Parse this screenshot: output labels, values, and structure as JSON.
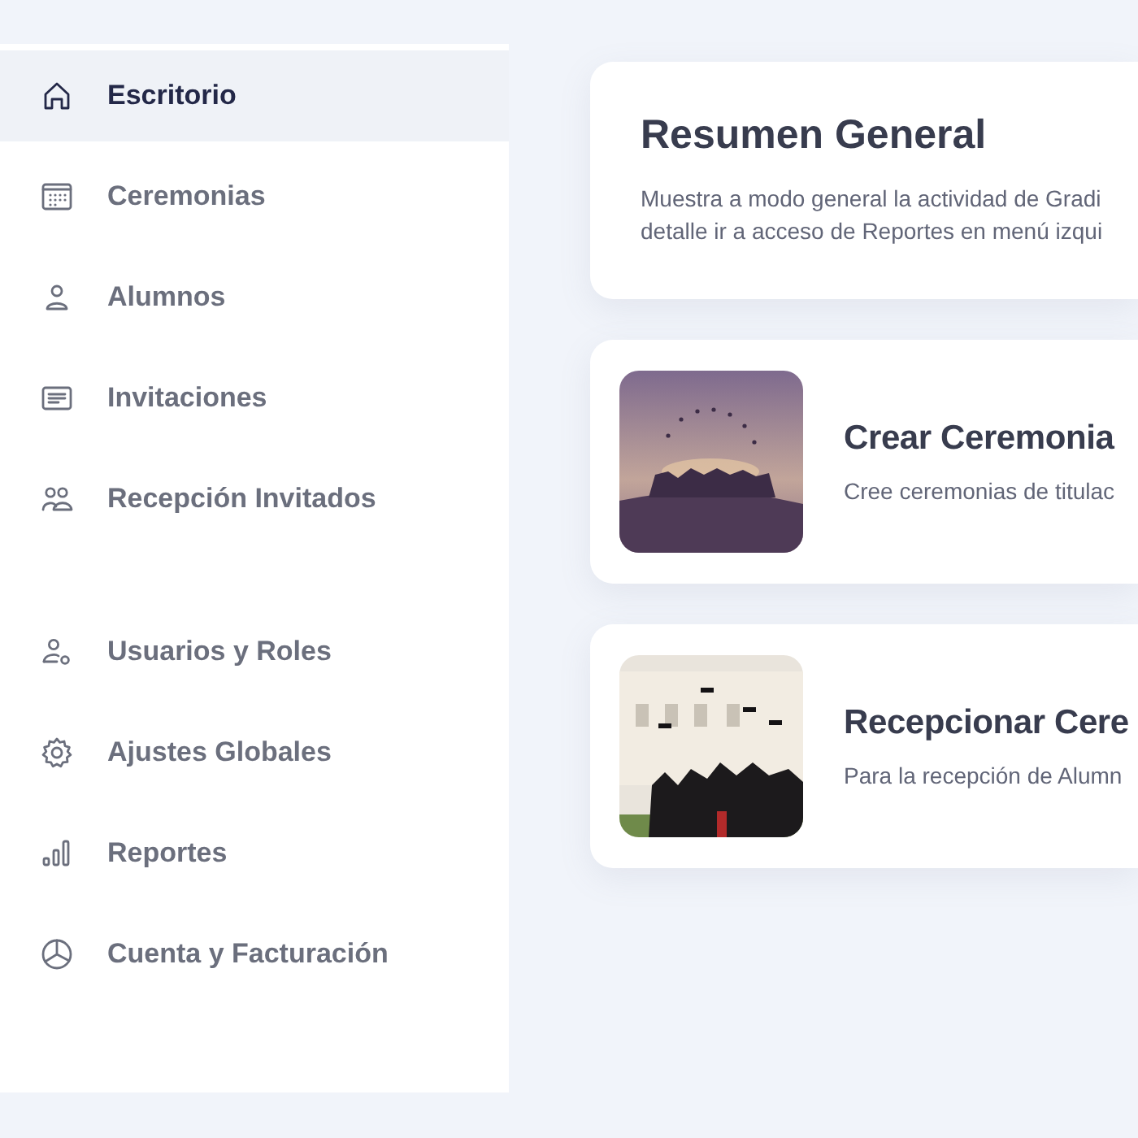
{
  "sidebar": {
    "sections": [
      {
        "items": [
          {
            "label": "Escritorio",
            "selected": true
          },
          {
            "label": "Ceremonias",
            "selected": false
          },
          {
            "label": "Alumnos",
            "selected": false
          },
          {
            "label": "Invitaciones",
            "selected": false
          },
          {
            "label": "Recepción Invitados",
            "selected": false
          }
        ]
      },
      {
        "items": [
          {
            "label": "Usuarios y Roles",
            "selected": false
          },
          {
            "label": "Ajustes Globales",
            "selected": false
          },
          {
            "label": "Reportes",
            "selected": false
          },
          {
            "label": "Cuenta y Facturación",
            "selected": false
          }
        ]
      }
    ]
  },
  "summary": {
    "title": "Resumen General",
    "lines": [
      "Muestra a modo general la actividad de Gradi",
      "detalle ir a acceso de Reportes en menú izqui"
    ]
  },
  "actions": [
    {
      "title": "Crear Ceremonia",
      "description": "Cree ceremonias de titulac"
    },
    {
      "title": "Recepcionar Cere",
      "description": "Para la recepción de Alumn"
    }
  ]
}
